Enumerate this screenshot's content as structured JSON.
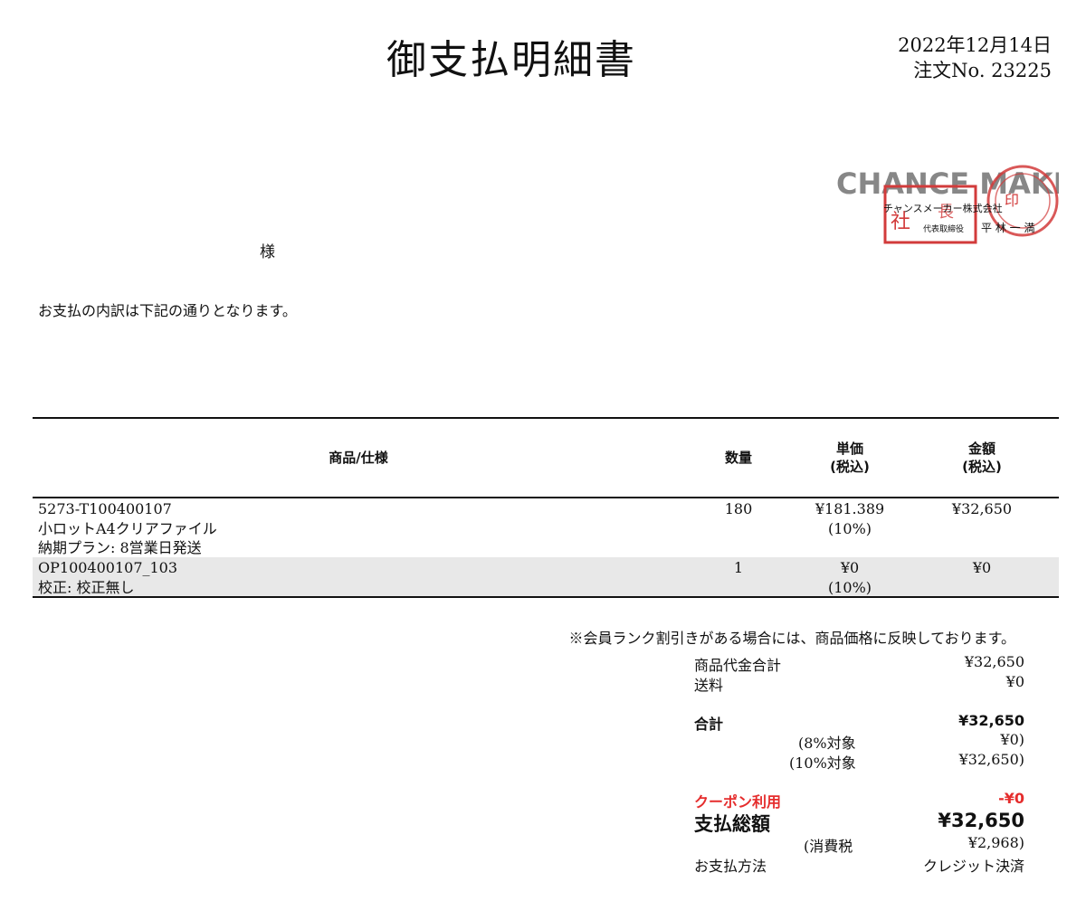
{
  "header": {
    "title": "御支払明細書",
    "date": "2022年12月14日",
    "order_no": "注文No. 23225"
  },
  "recipient": {
    "honorific": "様"
  },
  "intro": "お支払の内訳は下記の通りとなります。",
  "stamp": {
    "company": "チャンスメーカー株式会社",
    "role": "代表取締役",
    "name": "平 林 一 満",
    "logo_text": "CHANCE MAKER"
  },
  "table": {
    "headers": {
      "product": "商品/仕様",
      "qty": "数量",
      "unit_price_1": "単価",
      "unit_price_2": "(税込)",
      "amount_1": "金額",
      "amount_2": "(税込)"
    },
    "rows": [
      {
        "code": "5273-T100400107",
        "name": "小ロットA4クリアファイル",
        "spec": "納期プラン: 8営業日発送",
        "qty": "180",
        "unit_price": "¥181.389",
        "tax_rate": "(10%)",
        "amount": "¥32,650"
      },
      {
        "code": "OP100400107_103",
        "name": "校正: 校正無し",
        "qty": "1",
        "unit_price": "¥0",
        "tax_rate": "(10%)",
        "amount": "¥0"
      }
    ]
  },
  "note": "※会員ランク割引きがある場合には、商品価格に反映しております。",
  "summary": {
    "subtotal_label": "商品代金合計",
    "subtotal_value": "¥32,650",
    "shipping_label": "送料",
    "shipping_value": "¥0",
    "total_label": "合計",
    "total_value": "¥32,650",
    "tax8_label": "(8%対象",
    "tax8_value": "¥0)",
    "tax10_label": "(10%対象",
    "tax10_value": "¥32,650)",
    "coupon_label": "クーポン利用",
    "coupon_value": "-¥0",
    "grand_label": "支払総額",
    "grand_value": "¥32,650",
    "ctax_label": "(消費税",
    "ctax_value": "¥2,968)",
    "method_label": "お支払方法",
    "method_value": "クレジット決済"
  },
  "colors": {
    "stamp_red": "#d23b3b",
    "coupon_red": "#e52d2d",
    "row_shade": "#e8e8e8"
  }
}
